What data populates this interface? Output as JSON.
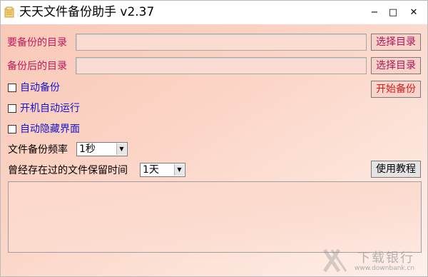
{
  "window": {
    "title": "天天文件备份助手 v2.37",
    "controls": {
      "minimize": "−",
      "maximize": "□",
      "close": "✕"
    }
  },
  "backup_source": {
    "label": "要备份的目录",
    "value": "",
    "button": "选择目录"
  },
  "backup_target": {
    "label": "备份后的目录",
    "value": "",
    "button": "选择目录"
  },
  "options": [
    {
      "label": "自动备份",
      "checked": false
    },
    {
      "label": "开机自动运行",
      "checked": false
    },
    {
      "label": "自动隐藏界面",
      "checked": false
    }
  ],
  "start_button": "开始备份",
  "frequency": {
    "label": "文件备份频率",
    "selected": "1秒"
  },
  "retention": {
    "label": "曾经存在过的文件保留时间",
    "selected": "1天"
  },
  "tutorial_button": "使用教程",
  "log": "",
  "watermark": {
    "text": "下载银行",
    "url": "www.downbank.cn"
  },
  "colors": {
    "label_pink": "#c2185b",
    "label_blue": "#1515c8",
    "start_red": "#d81b1b",
    "background": "#fbd3c4"
  }
}
